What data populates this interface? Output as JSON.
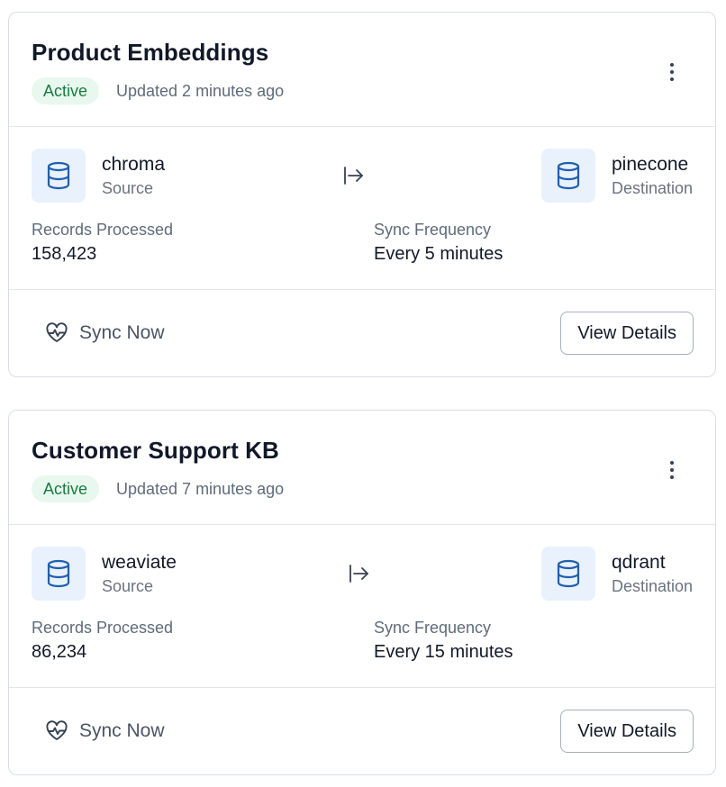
{
  "pipelines": [
    {
      "title": "Product Embeddings",
      "status": "Active",
      "updated": "Updated 2 minutes ago",
      "source": {
        "name": "chroma",
        "role": "Source"
      },
      "destination": {
        "name": "pinecone",
        "role": "Destination"
      },
      "records_label": "Records Processed",
      "records_value": "158,423",
      "frequency_label": "Sync Frequency",
      "frequency_value": "Every 5 minutes",
      "sync_label": "Sync Now",
      "details_label": "View Details"
    },
    {
      "title": "Customer Support KB",
      "status": "Active",
      "updated": "Updated 7 minutes ago",
      "source": {
        "name": "weaviate",
        "role": "Source"
      },
      "destination": {
        "name": "qdrant",
        "role": "Destination"
      },
      "records_label": "Records Processed",
      "records_value": "86,234",
      "frequency_label": "Sync Frequency",
      "frequency_value": "Every 15 minutes",
      "sync_label": "Sync Now",
      "details_label": "View Details"
    }
  ],
  "colors": {
    "status_bg": "#e8f8ee",
    "status_text": "#1b7a43",
    "db_icon_bg": "#e8f1fc",
    "db_icon_stroke": "#1f5fae"
  },
  "icons": {
    "menu": "more-vertical-icon",
    "database": "database-icon",
    "arrow": "arrow-right-to-line-icon",
    "sync": "heart-pulse-icon"
  }
}
